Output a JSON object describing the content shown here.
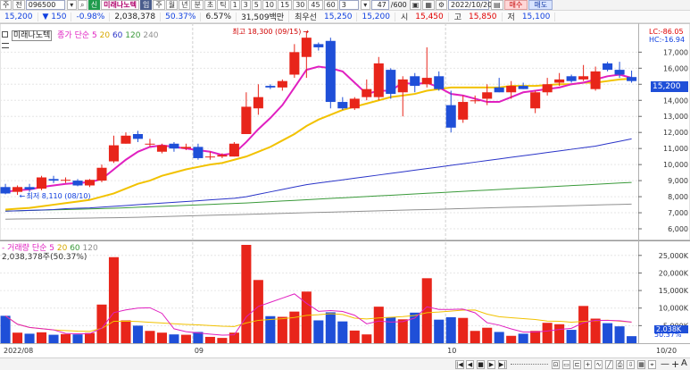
{
  "toolbar": {
    "left_items": [
      "주",
      "전"
    ],
    "code": "096500",
    "stock_name": "미래나노텍",
    "icon_tags": [
      "신",
      "임"
    ],
    "periods": [
      "주",
      "월",
      "년",
      "분",
      "초",
      "틱"
    ],
    "minutes": [
      "1",
      "3",
      "5",
      "10",
      "15",
      "30",
      "45",
      "60"
    ],
    "n_value": "3",
    "count": "47",
    "count_total": "/600",
    "date": "2022/10/20",
    "buy": "매수",
    "sell": "매도"
  },
  "quote": {
    "price": "15,200",
    "change": "150",
    "change_pct": "-0.98%",
    "volume": "2,038,378",
    "vol_ratio": "50.37%",
    "turnover": "6.57%",
    "amount": "31,509백만",
    "best_bid_label": "최우선",
    "best_ask": "15,250",
    "best_bid": "15,200",
    "open_label": "시",
    "open": "15,450",
    "high_label": "고",
    "high": "15,850",
    "low_label": "저",
    "low": "15,100"
  },
  "legend_price": {
    "name": "미래나노텍",
    "series_title": "종가 단순",
    "ma": [
      "5",
      "20",
      "60",
      "120",
      "240"
    ]
  },
  "legend_volume": {
    "title": "거래량 단순",
    "ma": [
      "5",
      "20",
      "60",
      "120"
    ],
    "readout": "2,038,378주(50.37%)"
  },
  "lc_hc": {
    "lc": "LC:-86.05",
    "hc": "HC:-16.94"
  },
  "vol_tag": "2,038K",
  "vol_ratio_tag": "50.37%",
  "price_tag": "15,200",
  "colors": {
    "up": "#e8251a",
    "down": "#1f4fd8",
    "ma5": "#e020c0",
    "ma20": "#f2c200",
    "ma60": "#2a34c8",
    "ma120": "#3a9a3a",
    "ma240": "#909090"
  },
  "chart_data": {
    "type": "candlestick",
    "date_labels": [
      "2022/08",
      "09",
      "10",
      "10/20"
    ],
    "price_axis": [
      "17,000",
      "16,000",
      "15,000",
      "14,000",
      "13,000",
      "12,000",
      "11,000",
      "10,000",
      "9,000",
      "8,000",
      "7,000",
      "6,000"
    ],
    "volume_axis": [
      "25,000K",
      "20,000K",
      "15,000K",
      "10,000K",
      "5,000K"
    ],
    "annotations": {
      "high": "최고 18,300 (09/15)",
      "low": "최저 8,110 (08/10)"
    },
    "ylim": [
      5500,
      18800
    ],
    "vol_ylim": [
      0,
      28000
    ],
    "candles": [
      {
        "o": 8600,
        "h": 8800,
        "l": 8150,
        "c": 8200,
        "v": 7800
      },
      {
        "o": 8300,
        "h": 8700,
        "l": 8110,
        "c": 8600,
        "v": 3000
      },
      {
        "o": 8600,
        "h": 8800,
        "l": 8300,
        "c": 8450,
        "v": 2700
      },
      {
        "o": 8500,
        "h": 9300,
        "l": 8400,
        "c": 9200,
        "v": 3100
      },
      {
        "o": 9100,
        "h": 9300,
        "l": 8850,
        "c": 9000,
        "v": 2400
      },
      {
        "o": 9000,
        "h": 9200,
        "l": 8850,
        "c": 9050,
        "v": 2600
      },
      {
        "o": 9000,
        "h": 9100,
        "l": 8650,
        "c": 8700,
        "v": 2500
      },
      {
        "o": 8700,
        "h": 9100,
        "l": 8600,
        "c": 9050,
        "v": 2900
      },
      {
        "o": 9000,
        "h": 10000,
        "l": 8900,
        "c": 9800,
        "v": 11000
      },
      {
        "o": 10200,
        "h": 11800,
        "l": 10100,
        "c": 11200,
        "v": 24500
      },
      {
        "o": 11300,
        "h": 12000,
        "l": 11300,
        "c": 11800,
        "v": 6500
      },
      {
        "o": 11900,
        "h": 12100,
        "l": 11400,
        "c": 11600,
        "v": 5000
      },
      {
        "o": 11300,
        "h": 11600,
        "l": 11100,
        "c": 11300,
        "v": 3500
      },
      {
        "o": 10800,
        "h": 11300,
        "l": 10700,
        "c": 11200,
        "v": 3000
      },
      {
        "o": 11300,
        "h": 11400,
        "l": 10800,
        "c": 11000,
        "v": 2500
      },
      {
        "o": 11000,
        "h": 11300,
        "l": 10900,
        "c": 11100,
        "v": 2400
      },
      {
        "o": 11100,
        "h": 11300,
        "l": 10300,
        "c": 10400,
        "v": 3200
      },
      {
        "o": 10500,
        "h": 10800,
        "l": 10300,
        "c": 10500,
        "v": 1800
      },
      {
        "o": 10500,
        "h": 10700,
        "l": 10400,
        "c": 10600,
        "v": 1500
      },
      {
        "o": 10500,
        "h": 11400,
        "l": 10500,
        "c": 11300,
        "v": 3000
      },
      {
        "o": 11900,
        "h": 14500,
        "l": 11900,
        "c": 13600,
        "v": 28000
      },
      {
        "o": 13500,
        "h": 15000,
        "l": 13100,
        "c": 14200,
        "v": 18000
      },
      {
        "o": 14900,
        "h": 15000,
        "l": 14700,
        "c": 14800,
        "v": 7700
      },
      {
        "o": 14800,
        "h": 15300,
        "l": 14600,
        "c": 15200,
        "v": 7500
      },
      {
        "o": 15600,
        "h": 17500,
        "l": 15400,
        "c": 17000,
        "v": 9000
      },
      {
        "o": 16700,
        "h": 18300,
        "l": 15400,
        "c": 17900,
        "v": 14700
      },
      {
        "o": 17500,
        "h": 17600,
        "l": 17100,
        "c": 17300,
        "v": 6500
      },
      {
        "o": 17700,
        "h": 17900,
        "l": 13500,
        "c": 13900,
        "v": 8800
      },
      {
        "o": 13900,
        "h": 14200,
        "l": 13400,
        "c": 13500,
        "v": 6200
      },
      {
        "o": 13500,
        "h": 14200,
        "l": 13400,
        "c": 14100,
        "v": 3600
      },
      {
        "o": 14200,
        "h": 15300,
        "l": 14000,
        "c": 14700,
        "v": 2500
      },
      {
        "o": 14200,
        "h": 16700,
        "l": 14000,
        "c": 16300,
        "v": 10400
      },
      {
        "o": 15900,
        "h": 16000,
        "l": 14100,
        "c": 14400,
        "v": 7400
      },
      {
        "o": 14500,
        "h": 15500,
        "l": 13000,
        "c": 15300,
        "v": 6800
      },
      {
        "o": 15500,
        "h": 15700,
        "l": 14500,
        "c": 14900,
        "v": 8700
      },
      {
        "o": 15000,
        "h": 17300,
        "l": 14800,
        "c": 15400,
        "v": 18500
      },
      {
        "o": 15500,
        "h": 15800,
        "l": 14600,
        "c": 14700,
        "v": 6700
      },
      {
        "o": 13700,
        "h": 14600,
        "l": 12000,
        "c": 12300,
        "v": 7400
      },
      {
        "o": 12800,
        "h": 14300,
        "l": 12600,
        "c": 13900,
        "v": 7200
      },
      {
        "o": 14000,
        "h": 14300,
        "l": 13800,
        "c": 14000,
        "v": 3500
      },
      {
        "o": 14100,
        "h": 15000,
        "l": 13700,
        "c": 14500,
        "v": 4400
      },
      {
        "o": 14800,
        "h": 15400,
        "l": 14500,
        "c": 14500,
        "v": 3200
      },
      {
        "o": 14500,
        "h": 15200,
        "l": 14100,
        "c": 14900,
        "v": 2100
      },
      {
        "o": 14900,
        "h": 15100,
        "l": 14700,
        "c": 14700,
        "v": 2700
      },
      {
        "o": 13500,
        "h": 14600,
        "l": 13200,
        "c": 14500,
        "v": 3500
      },
      {
        "o": 14500,
        "h": 15400,
        "l": 14300,
        "c": 15000,
        "v": 5800
      },
      {
        "o": 15100,
        "h": 15700,
        "l": 14900,
        "c": 15300,
        "v": 5400
      },
      {
        "o": 15500,
        "h": 15600,
        "l": 15100,
        "c": 15200,
        "v": 3800
      },
      {
        "o": 15300,
        "h": 16200,
        "l": 15200,
        "c": 15500,
        "v": 10600
      },
      {
        "o": 14700,
        "h": 16100,
        "l": 14600,
        "c": 15800,
        "v": 7000
      },
      {
        "o": 16300,
        "h": 16400,
        "l": 15800,
        "c": 15900,
        "v": 5700
      },
      {
        "o": 15900,
        "h": 16400,
        "l": 15400,
        "c": 15600,
        "v": 4800
      },
      {
        "o": 15450,
        "h": 15850,
        "l": 15100,
        "c": 15200,
        "v": 2000
      }
    ],
    "ma5": [
      8300,
      8400,
      8450,
      8600,
      8700,
      8800,
      8850,
      8900,
      9100,
      9700,
      10300,
      10800,
      11100,
      11200,
      11100,
      11000,
      10900,
      10800,
      10600,
      10700,
      11400,
      12200,
      12900,
      13700,
      14800,
      15900,
      16100,
      16000,
      15800,
      15100,
      14400,
      14600,
      14600,
      15100,
      15000,
      15100,
      14800,
      14400,
      14300,
      14100,
      13900,
      13900,
      14200,
      14500,
      14600,
      14700,
      14800,
      15000,
      15100,
      15300,
      15500,
      15600,
      15400
    ],
    "ma20": [
      7200,
      7250,
      7300,
      7400,
      7500,
      7600,
      7700,
      7800,
      8000,
      8200,
      8500,
      8800,
      9000,
      9300,
      9500,
      9700,
      9850,
      10000,
      10100,
      10300,
      10500,
      10800,
      11100,
      11500,
      11900,
      12400,
      12800,
      13100,
      13400,
      13600,
      13800,
      14000,
      14200,
      14300,
      14400,
      14600,
      14700,
      14800,
      14800,
      14800,
      14800,
      14800,
      14900,
      14900,
      14900,
      14950,
      15000,
      15000,
      15100,
      15100,
      15200,
      15300,
      15350
    ],
    "ma60": [
      7100,
      7120,
      7150,
      7170,
      7200,
      7250,
      7280,
      7300,
      7350,
      7400,
      7450,
      7500,
      7550,
      7600,
      7650,
      7700,
      7750,
      7800,
      7850,
      7900,
      8000,
      8150,
      8300,
      8450,
      8600,
      8750,
      8850,
      8950,
      9050,
      9150,
      9250,
      9350,
      9450,
      9550,
      9650,
      9750,
      9850,
      9950,
      10050,
      10150,
      10250,
      10350,
      10450,
      10550,
      10650,
      10750,
      10850,
      10950,
      11050,
      11150,
      11300,
      11450,
      11600
    ],
    "ma120": [
      7100,
      7120,
      7140,
      7160,
      7180,
      7200,
      7220,
      7240,
      7260,
      7280,
      7310,
      7340,
      7370,
      7400,
      7430,
      7460,
      7490,
      7520,
      7550,
      7580,
      7610,
      7650,
      7690,
      7730,
      7770,
      7810,
      7850,
      7890,
      7930,
      7970,
      8010,
      8050,
      8090,
      8130,
      8170,
      8210,
      8250,
      8290,
      8330,
      8370,
      8410,
      8450,
      8490,
      8530,
      8570,
      8610,
      8650,
      8690,
      8730,
      8770,
      8810,
      8850,
      8890
    ],
    "ma240": [
      6600,
      6610,
      6620,
      6630,
      6640,
      6650,
      6660,
      6670,
      6680,
      6690,
      6700,
      6720,
      6740,
      6760,
      6780,
      6800,
      6820,
      6840,
      6860,
      6880,
      6900,
      6920,
      6940,
      6960,
      6980,
      7000,
      7020,
      7040,
      7060,
      7080,
      7100,
      7120,
      7140,
      7160,
      7180,
      7200,
      7220,
      7240,
      7260,
      7280,
      7300,
      7320,
      7340,
      7360,
      7380,
      7400,
      7420,
      7440,
      7460,
      7480,
      7500,
      7520,
      7540
    ]
  }
}
